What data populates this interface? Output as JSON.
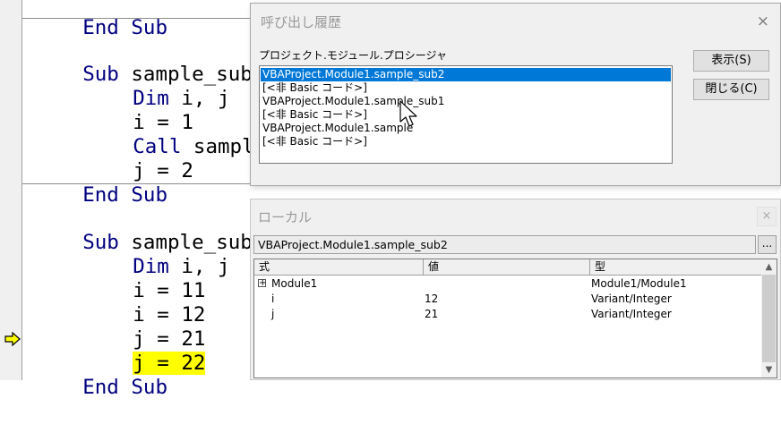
{
  "editor": {
    "lines": [
      {
        "kw": "End Sub",
        "rest": ""
      },
      {
        "kw": "Sub",
        "rest": " sample_sub1()"
      },
      {
        "kw": "Dim",
        "rest": " i, j"
      },
      {
        "kw": "",
        "rest": "i = 1"
      },
      {
        "kw": "Call",
        "rest": " sample_sub2"
      },
      {
        "kw": "",
        "rest": "j = 2"
      },
      {
        "kw": "End Sub",
        "rest": ""
      },
      {
        "kw": "Sub",
        "rest": " sample_sub2()"
      },
      {
        "kw": "Dim",
        "rest": " i, j"
      },
      {
        "kw": "",
        "rest": "i = 11"
      },
      {
        "kw": "",
        "rest": "i = 12"
      },
      {
        "kw": "",
        "rest": "j = 21"
      },
      {
        "kw": "",
        "rest": "j = 22"
      },
      {
        "kw": "End Sub",
        "rest": ""
      }
    ],
    "current_line_highlight": "#ffff00",
    "current_line_arrow": "yellow-arrow-icon"
  },
  "call_stack": {
    "title": "呼び出し履歴",
    "list_label": "プロジェクト.モジュール.プロシージャ",
    "items": [
      "VBAProject.Module1.sample_sub2",
      "[<非 Basic コード>]",
      "VBAProject.Module1.sample_sub1",
      "[<非 Basic コード>]",
      "VBAProject.Module1.sample",
      "[<非 Basic コード>]"
    ],
    "selected_index": 0,
    "show_button": "表示(S)",
    "close_button": "閉じる(C)",
    "close_icon": "×"
  },
  "locals": {
    "title": "ローカル",
    "context": "VBAProject.Module1.sample_sub2",
    "more_button": "...",
    "columns": [
      "式",
      "値",
      "型"
    ],
    "rows": [
      {
        "expand": "+",
        "name": "Module1",
        "value": "",
        "type": "Module1/Module1"
      },
      {
        "expand": "",
        "name": "i",
        "value": "12",
        "type": "Variant/Integer"
      },
      {
        "expand": "",
        "name": "j",
        "value": "21",
        "type": "Variant/Integer"
      }
    ],
    "close_icon": "×",
    "scroll_up": "▲",
    "scroll_down": "▼"
  },
  "colors": {
    "keyword": "#000080",
    "selection": "#0078d7"
  }
}
